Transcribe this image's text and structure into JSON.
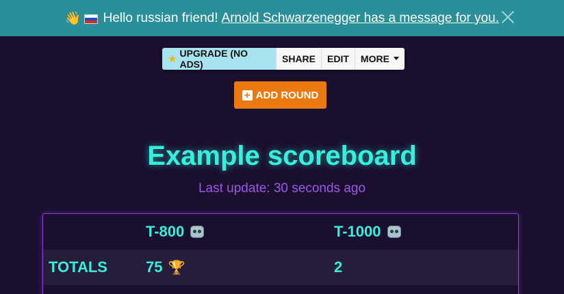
{
  "banner": {
    "wave_icon": "👋",
    "flag_icon": "russian-flag-icon",
    "message": "Hello russian friend!",
    "link_text": "Arnold Schwarzenegger has a message for you."
  },
  "toolbar": {
    "upgrade_label": "UPGRADE (NO ADS)",
    "share_label": "SHARE",
    "edit_label": "EDIT",
    "more_label": "MORE"
  },
  "add_round_label": "ADD ROUND",
  "scoreboard": {
    "title": "Example scoreboard",
    "last_update": "Last update: 30 seconds ago",
    "players": [
      {
        "name": "T-800",
        "icon": "robot-icon"
      },
      {
        "name": "T-1000",
        "icon": "robot-icon"
      }
    ],
    "totals_label": "TOTALS",
    "totals": [
      "75",
      "2"
    ],
    "leader_icon": "trophy-icon"
  },
  "colors": {
    "background": "#1a0f2e",
    "banner": "#2b8f9a",
    "accent": "#35f0dc",
    "update_text": "#9b59e6",
    "add_round": "#ea7a10",
    "upgrade": "#a8e4ef",
    "board_border": "#8e44d8"
  }
}
